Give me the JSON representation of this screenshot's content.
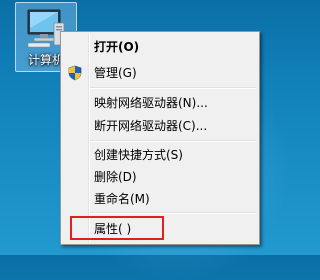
{
  "desktop": {
    "icon_label": "计算机",
    "icon_name": "computer-icon"
  },
  "context_menu": {
    "items": [
      {
        "label": "打开(O)",
        "bold": true
      },
      {
        "label": "管理(G)",
        "icon": "uac-shield-icon"
      },
      {
        "label": "映射网络驱动器(N)..."
      },
      {
        "label": "断开网络驱动器(C)..."
      },
      {
        "label": "创建快捷方式(S)"
      },
      {
        "label": "删除(D)"
      },
      {
        "label": "重命名(M)"
      },
      {
        "label": "属性(  )"
      }
    ]
  },
  "annotation": {
    "highlight_color": "#e02020"
  }
}
